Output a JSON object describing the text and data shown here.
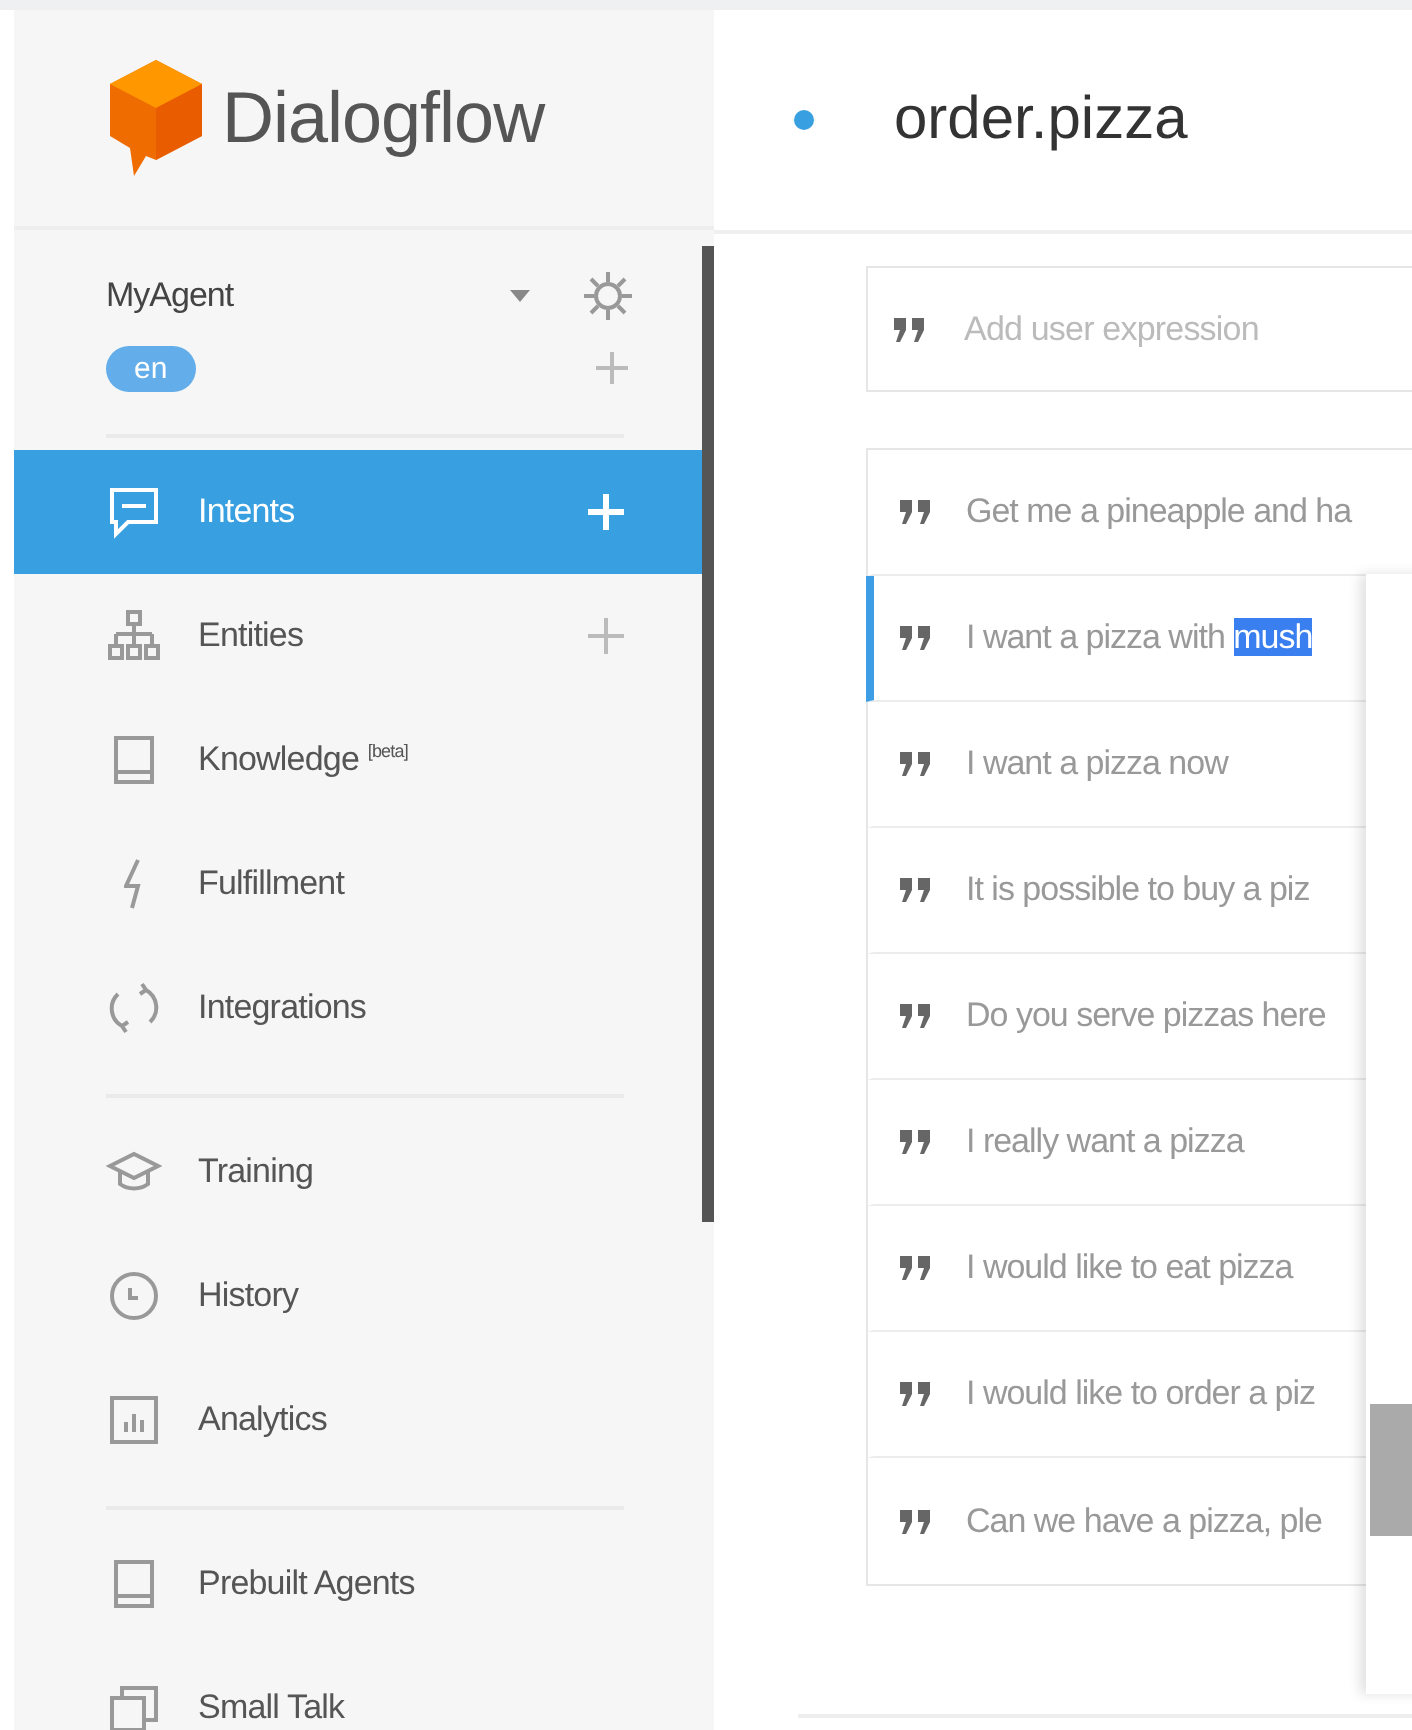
{
  "brand": {
    "name": "Dialogflow"
  },
  "agent": {
    "name": "MyAgent",
    "language": "en"
  },
  "sidebar": {
    "sections": [
      {
        "items": [
          {
            "label": "Intents",
            "selected": true,
            "add": true
          },
          {
            "label": "Entities",
            "selected": false,
            "add": true
          },
          {
            "label": "Knowledge $^{[beta]}$",
            "selected": false,
            "add": false
          },
          {
            "label": "Fulfillment",
            "selected": false,
            "add": false
          },
          {
            "label": "Integrations",
            "selected": false,
            "add": false
          }
        ]
      },
      {
        "items": [
          {
            "label": "Training",
            "selected": false,
            "add": false
          },
          {
            "label": "History",
            "selected": false,
            "add": false
          },
          {
            "label": "Analytics",
            "selected": false,
            "add": false
          }
        ]
      },
      {
        "items": [
          {
            "label": "Prebuilt Agents",
            "selected": false,
            "add": false
          },
          {
            "label": "Small Talk",
            "selected": false,
            "add": false
          }
        ]
      }
    ]
  },
  "intent": {
    "title": "order.pizza"
  },
  "expression_field": {
    "placeholder": "Add user expression"
  },
  "expressions": [
    {
      "text": "Get me a pineapple and ha",
      "selected": false
    },
    {
      "text": "I want a pizza with ",
      "highlight": "mush",
      "selected": true
    },
    {
      "text": "I want a pizza now",
      "selected": false
    },
    {
      "text": "It is possible to buy a piz",
      "selected": false
    },
    {
      "text": "Do you serve pizzas here",
      "selected": false
    },
    {
      "text": "I really want a pizza",
      "selected": false
    },
    {
      "text": "I would like to eat pizza",
      "selected": false
    },
    {
      "text": "I would like to order a piz",
      "selected": false
    },
    {
      "text": "Can we have a pizza, ple",
      "selected": false
    }
  ]
}
